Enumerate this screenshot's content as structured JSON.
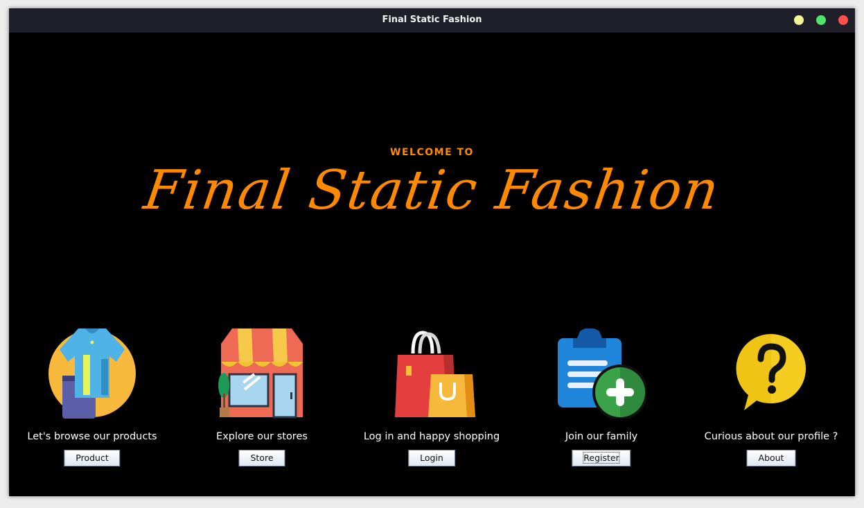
{
  "window": {
    "title": "Final Static Fashion"
  },
  "hero": {
    "welcome": "WELCOME TO",
    "brand": "Final Static Fashion"
  },
  "colors": {
    "accent": "#ff8a00",
    "background": "#000000",
    "titlebar": "#1e1f29"
  },
  "cards": [
    {
      "icon": "clothing-icon",
      "caption": "Let's browse our products",
      "button": "Product"
    },
    {
      "icon": "storefront-icon",
      "caption": "Explore our stores",
      "button": "Store"
    },
    {
      "icon": "shopping-bags-icon",
      "caption": "Log in and happy shopping",
      "button": "Login"
    },
    {
      "icon": "clipboard-add-icon",
      "caption": "Join our family",
      "button": "Register"
    },
    {
      "icon": "question-bubble-icon",
      "caption": "Curious about our profile ?",
      "button": "About"
    }
  ]
}
